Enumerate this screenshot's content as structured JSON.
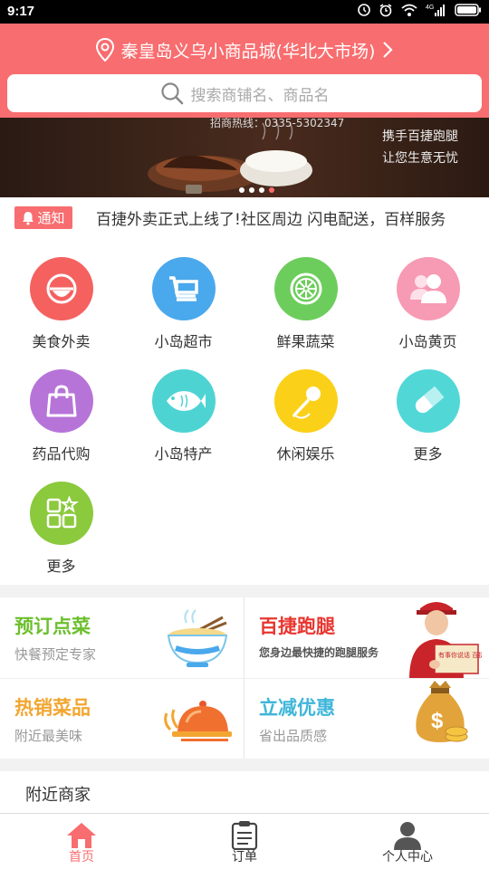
{
  "status_bar": {
    "time": "9:17"
  },
  "header": {
    "location": "秦皇岛义乌小商品城(华北大市场)",
    "search_placeholder": "搜索商铺名、商品名"
  },
  "banner": {
    "hotline": "招商热线：0335-5302347",
    "slogan_line1": "携手百捷跑腿",
    "slogan_line2": "让您生意无忧",
    "dot_count": 4,
    "active_dot": 4
  },
  "notice": {
    "badge": "通知",
    "text": "百捷外卖正式上线了!社区周边 闪电配送，百样服务"
  },
  "categories": [
    {
      "label": "美食外卖",
      "icon": "bowl-icon",
      "color": "#f4615f"
    },
    {
      "label": "小岛超市",
      "icon": "cart-icon",
      "color": "#4aa8ec"
    },
    {
      "label": "鲜果蔬菜",
      "icon": "lemon-icon",
      "color": "#6dcd5c"
    },
    {
      "label": "小岛黄页",
      "icon": "people-icon",
      "color": "#f79ab4"
    },
    {
      "label": "药品代购",
      "icon": "bag-icon",
      "color": "#b774d8"
    },
    {
      "label": "小岛特产",
      "icon": "fish-icon",
      "color": "#4ed3d3"
    },
    {
      "label": "休闲娱乐",
      "icon": "microphone-icon",
      "color": "#fbd019"
    },
    {
      "label": "更多",
      "icon": "pill-icon",
      "color": "#52d7d7"
    },
    {
      "label": "更多",
      "icon": "apps-icon",
      "color": "#8bc93d"
    }
  ],
  "promos": {
    "reserve": {
      "title": "预订点菜",
      "subtitle": "快餐预定专家",
      "color": "#6bbf2c"
    },
    "errand": {
      "title": "百捷跑腿",
      "subtitle": "您身边最快捷的跑腿服务",
      "color": "#e8352f",
      "sign": "有事你说话 百捷来跑腿"
    },
    "hot": {
      "title": "热销菜品",
      "subtitle": "附近最美味",
      "color": "#f2a631"
    },
    "discount": {
      "title": "立减优惠",
      "subtitle": "省出品质感",
      "color": "#3fb6d9"
    }
  },
  "nearby": {
    "title": "附近商家"
  },
  "tabbar": {
    "home": "首页",
    "orders": "订单",
    "profile": "个人中心"
  }
}
